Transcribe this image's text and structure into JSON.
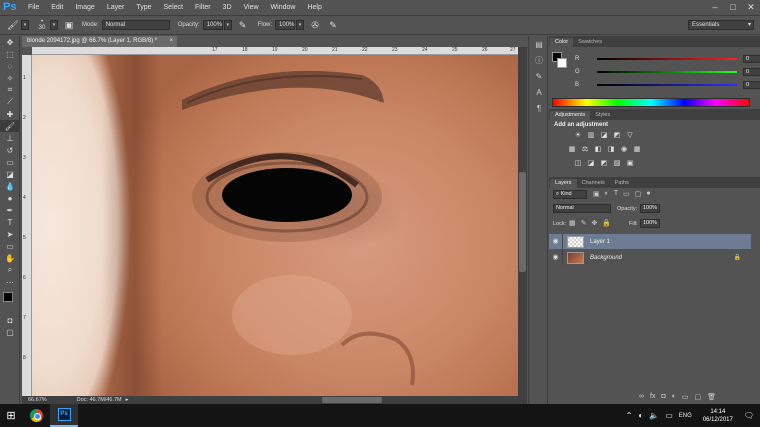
{
  "app": {
    "logo": "Ps"
  },
  "menu": [
    "File",
    "Edit",
    "Image",
    "Layer",
    "Type",
    "Select",
    "Filter",
    "3D",
    "View",
    "Window",
    "Help"
  ],
  "window_controls": [
    "–",
    "□",
    "✕"
  ],
  "options": {
    "brush_size": "30",
    "mode_label": "Mode:",
    "mode_value": "Normal",
    "opacity_label": "Opacity:",
    "opacity_value": "100%",
    "flow_label": "Flow:",
    "flow_value": "100%",
    "workspace": "Essentials"
  },
  "document": {
    "tab_title": "blonde 2094172.jpg @ 66.7% (Layer 1, RGB/8) *",
    "close": "×",
    "ruler_top": [
      "17",
      "18",
      "19",
      "20",
      "21",
      "22",
      "23",
      "24",
      "25",
      "26",
      "27"
    ],
    "ruler_left": [
      "1",
      "2",
      "3",
      "4",
      "5",
      "6",
      "7",
      "8"
    ],
    "zoom": "66.67%",
    "doc_size": "Doc: 46.7M/46.7M"
  },
  "color_panel": {
    "tabs": [
      "Color",
      "Swatches"
    ],
    "sliders": [
      {
        "label": "R",
        "value": "0",
        "color": "#ff2020"
      },
      {
        "label": "G",
        "value": "0",
        "color": "#20ff20"
      },
      {
        "label": "B",
        "value": "0",
        "color": "#3030ff"
      }
    ]
  },
  "adjustments_panel": {
    "tabs": [
      "Adjustments",
      "Styles"
    ],
    "heading": "Add an adjustment",
    "row1": [
      "☀",
      "▥",
      "◪",
      "◩",
      "▽"
    ],
    "row2": [
      "▦",
      "⚖",
      "◧",
      "◨",
      "◉",
      "▦"
    ],
    "row3": [
      "◫",
      "◪",
      "◩",
      "▨",
      "▣"
    ]
  },
  "layers_panel": {
    "tabs": [
      "Layers",
      "Channels",
      "Paths"
    ],
    "kind": "Kind",
    "blend_mode": "Normal",
    "opacity_label": "Opacity:",
    "opacity_value": "100%",
    "lock_label": "Lock:",
    "fill_label": "Fill:",
    "fill_value": "100%",
    "layers": [
      {
        "name": "Layer 1",
        "selected": true
      },
      {
        "name": "Background",
        "selected": false
      }
    ],
    "bottom_icons": [
      "∞",
      "fx",
      "◘",
      "◐",
      "▭",
      "▢",
      "🗑"
    ]
  },
  "taskbar": {
    "language": "ENG",
    "time": "14:14",
    "date": "06/12/2017"
  }
}
